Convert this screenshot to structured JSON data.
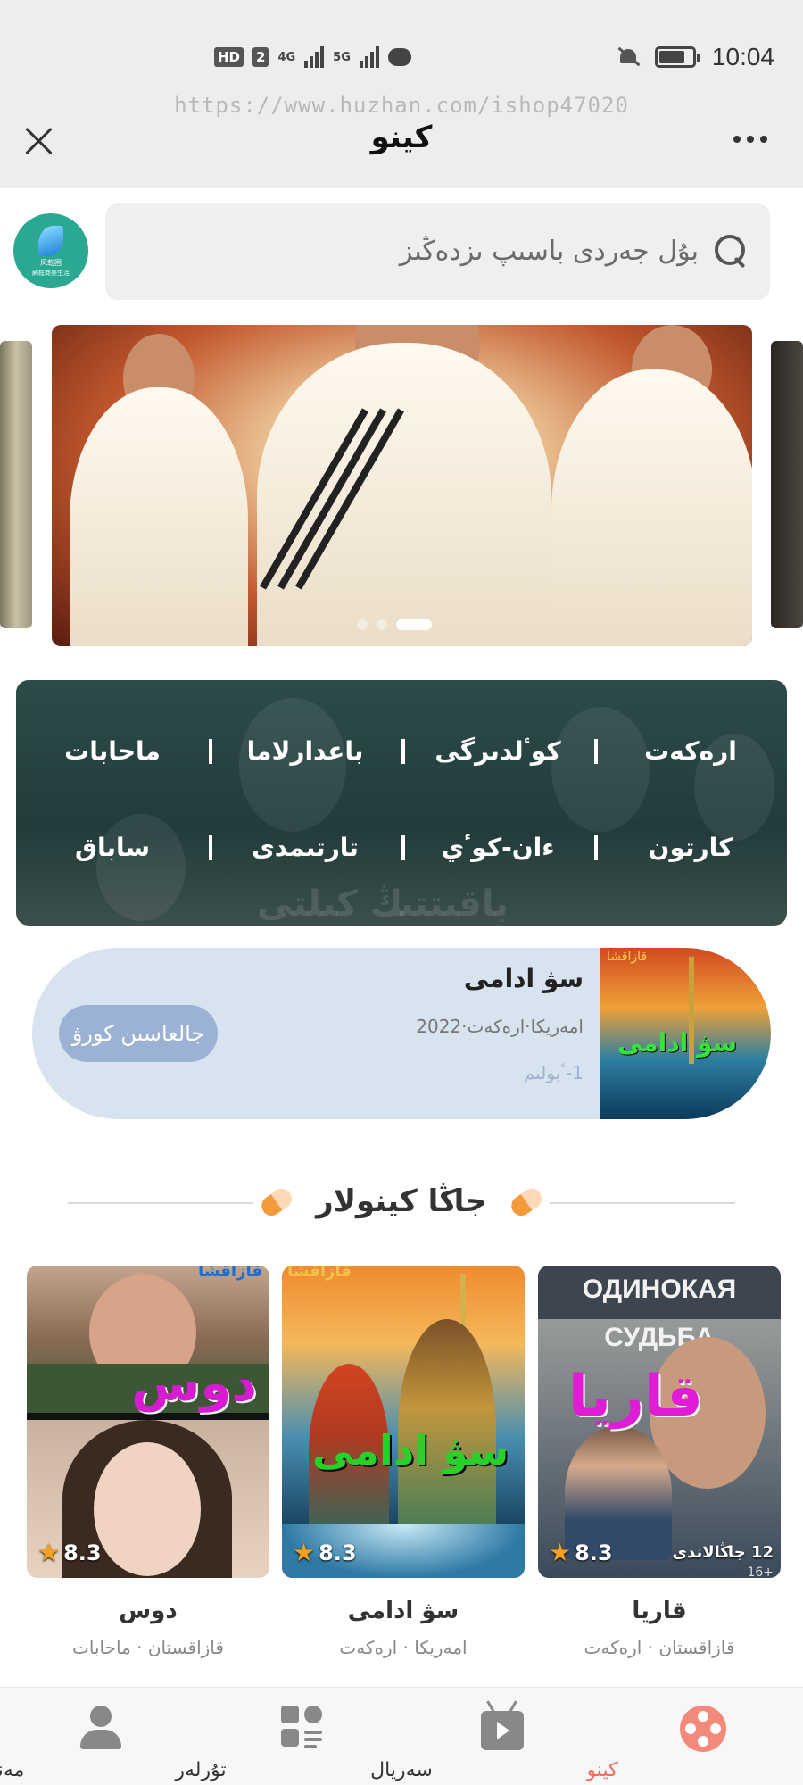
{
  "status_bar": {
    "hd": "HD",
    "hd_sim": "2",
    "net1": "4G",
    "net2": "5G",
    "time": "10:04"
  },
  "watermark": "https://www.huzhan.com/ishop47020",
  "header": {
    "title": "كينو"
  },
  "logo": {
    "line1": "风乾困",
    "line2": "刷框商美生活"
  },
  "search": {
    "placeholder": "بۇل جەردى باسىپ ىزدەڭىز"
  },
  "categories": {
    "row1": [
      "ارەكەت",
      "كوٴلدىرگى",
      "باعدارلاما",
      "ماحابات"
    ],
    "row2": [
      "كارتون",
      "ءان-كوٴي",
      "تارتىمدى",
      "ساباق"
    ],
    "watermark": "باقىتتىڭ كىلتى"
  },
  "resume": {
    "title": "سۋ ادامى",
    "meta": "امەريكا·ارەكەت·2022",
    "episode": "1-ٴبولىم",
    "button": "جالعاسىن كورۋ",
    "poster_label": "سۋ ادامى",
    "poster_tag": "قازاقشا"
  },
  "section": {
    "title": "جاڭا كينولار"
  },
  "movies": [
    {
      "name": "قاريا",
      "sub": "قازاقستان · ارەكەت",
      "rating": "8.3",
      "episodes": "12 جاڭالاندى",
      "age": "16+",
      "overlay": "قاريا",
      "poster_header": "ОДИНОКАЯ СУДЬБА"
    },
    {
      "name": "سۋ ادامى",
      "sub": "امەريكا · ارەكەت",
      "rating": "8.3",
      "overlay": "سۋ ادامى",
      "poster_tag": "قازاقشا"
    },
    {
      "name": "دوس",
      "sub": "قازاقستان · ماحابات",
      "rating": "8.3",
      "overlay": "دوس",
      "poster_tag": "قازاقشا"
    }
  ],
  "bottom_nav": [
    {
      "label": "كينو",
      "icon": "film-reel-icon",
      "active": true
    },
    {
      "label": "سەريال",
      "icon": "tv-icon",
      "active": false
    },
    {
      "label": "تۇرلەر",
      "icon": "category-grid-icon",
      "active": false
    },
    {
      "label": "مەنىڭ",
      "icon": "user-icon",
      "active": false
    }
  ],
  "colors": {
    "accent": "#f26b5b",
    "panel": "#2d4b4a",
    "resume_bg": "#d7e3ef",
    "resume_button": "#9cb2d5",
    "overlay_magenta": "#e01cd6",
    "overlay_green": "#26d229"
  }
}
